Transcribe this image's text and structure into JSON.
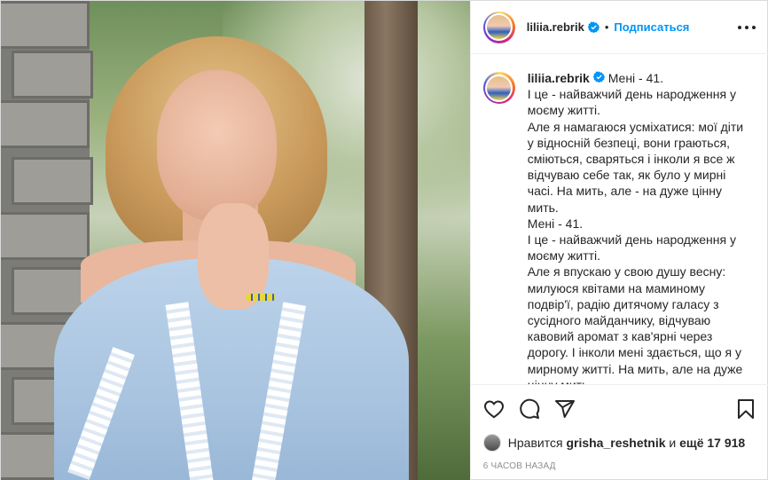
{
  "post": {
    "username": "liliia.rebrik",
    "separator": "•",
    "follow_label": "Подписаться",
    "more_icon": "more-horizontal-icon",
    "verified_color": "#0095f6",
    "accent_color": "#0095f6"
  },
  "caption": {
    "username": "liliia.rebrik",
    "lines": [
      "Мені - 41.",
      "І це - найважчий день народження у моєму житті.",
      "Але я намагаюся усміхатися: мої діти у відносній безпеці, вони граються, сміються, сваряться і інколи я все ж відчуваю себе так, як було у мирні часі. На мить, але - на дуже цінну мить.",
      "Мені - 41.",
      "І це - найважчий день народження у моєму житті.",
      "Але я впускаю у свою душу весну: милуюся квітами на маминому подвір'ї, радію дитячому галасу з сусідного майданчику, відчуваю кавовий аромат з кав'ярні через дорогу. І інколи мені здається, що я у мирному житті. На мить, але на дуже цінну мить."
    ]
  },
  "actions": {
    "like_icon": "heart-icon",
    "comment_icon": "comment-icon",
    "share_icon": "share-icon",
    "save_icon": "bookmark-icon"
  },
  "likes": {
    "prefix": "Нравится",
    "user": "grisha_reshetnik",
    "joiner": "и",
    "others": "ещё 17 918"
  },
  "timestamp": "6 часов назад"
}
